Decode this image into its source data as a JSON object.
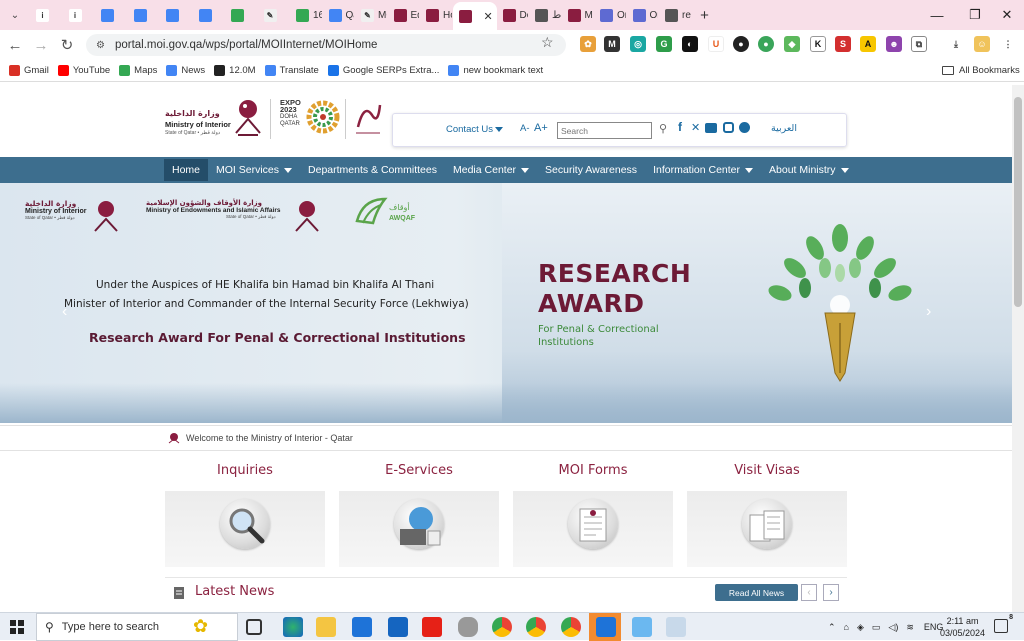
{
  "browser": {
    "tabs": [
      {
        "label": ""
      },
      {
        "label": ""
      },
      {
        "label": ""
      },
      {
        "label": ""
      },
      {
        "label": ""
      },
      {
        "label": ""
      },
      {
        "label": ""
      },
      {
        "label": ""
      },
      {
        "label": "16"
      },
      {
        "label": "Qa"
      },
      {
        "label": "MO"
      },
      {
        "label": "Edi"
      },
      {
        "label": "Ho"
      },
      {
        "label": ""
      },
      {
        "label": "De"
      },
      {
        "label": "ط"
      },
      {
        "label": "Ma"
      },
      {
        "label": "On"
      },
      {
        "label": "On"
      },
      {
        "label": "rer"
      }
    ],
    "new_tab": "+",
    "url": "portal.moi.gov.qa/wps/portal/MOIInternet/MOIHome",
    "bookmarks": [
      {
        "label": "Gmail",
        "color": "#d93025"
      },
      {
        "label": "YouTube",
        "color": "#ff0000"
      },
      {
        "label": "Maps",
        "color": "#34a853"
      },
      {
        "label": "News",
        "color": "#4285f4"
      },
      {
        "label": "12.0M",
        "color": "#222222"
      },
      {
        "label": "Translate",
        "color": "#4285f4"
      },
      {
        "label": "Google SERPs Extra...",
        "color": "#1a73e8"
      },
      {
        "label": "new bookmark text",
        "color": "#4285f4"
      }
    ],
    "all_bookmarks": "All Bookmarks"
  },
  "site": {
    "logo": {
      "arabic": "وزارة الداخلية",
      "english": "Ministry of Interior",
      "sub": "State of Qatar • دولة قطر"
    },
    "expo": {
      "l1": "EXPO",
      "l2": "2023",
      "l3": "DOHA",
      "l4": "QATAR"
    },
    "toolbar": {
      "contact": "Contact Us",
      "font_minus": "A-",
      "font_plus": "A+",
      "search_placeholder": "Search",
      "arabic": "العربية"
    },
    "nav": [
      "Home",
      "MOI Services",
      "Departments & Committees",
      "Media Center",
      "Security Awareness",
      "Information Center",
      "About Ministry"
    ],
    "hero": {
      "logo1_ar": "وزارة الداخلية",
      "logo1_en": "Ministry of Interior",
      "logo1_sub": "State of Qatar • دولة قطر",
      "logo2_ar": "وزارة الأوقاف والشؤون الإسلامية",
      "logo2_en": "Ministry of Endowments and Islamic Affairs",
      "logo2_sub": "State of Qatar • دولة قطر",
      "logo3_ar": "أوقاف",
      "logo3_en": "AWQAF",
      "line1": "Under the Auspices of HE Khalifa bin Hamad bin Khalifa Al Thani",
      "line2": "Minister of Interior and Commander of the Internal Security Force (Lekhwiya)",
      "line3": "Research Award For Penal & Correctional Institutions",
      "award_t1": "RESEARCH",
      "award_t2": "AWARD",
      "award_s1": "For Penal & Correctional",
      "award_s2": "Institutions"
    },
    "welcome": "Welcome to the Ministry of Interior - Qatar",
    "services": [
      {
        "label": "Inquiries"
      },
      {
        "label": "E-Services"
      },
      {
        "label": "MOI Forms"
      },
      {
        "label": "Visit Visas"
      }
    ],
    "latest_news": "Latest News",
    "read_all": "Read All News"
  },
  "taskbar": {
    "search": "Type here to search",
    "lang": "ENG",
    "time": "2:11 am",
    "date": "03/05/2024",
    "notif": "8"
  }
}
